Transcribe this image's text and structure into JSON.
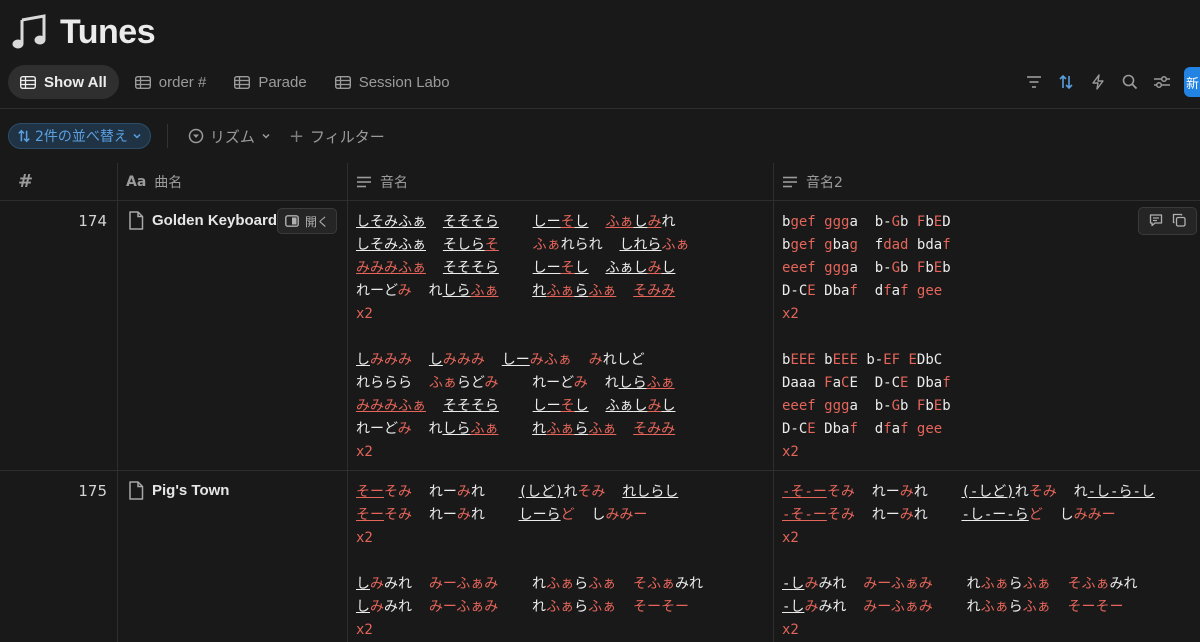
{
  "page": {
    "title": "Tunes",
    "icon": "music-notes-icon"
  },
  "views": [
    {
      "label": "Show All",
      "active": true
    },
    {
      "label": "order #",
      "active": false
    },
    {
      "label": "Parade",
      "active": false
    },
    {
      "label": "Session Labo",
      "active": false
    }
  ],
  "toolbar": {
    "new_label": "新"
  },
  "filters": {
    "sort_label": "2件の並べ替え",
    "rhythm_label": "リズム",
    "add_filter_label": "フィルター"
  },
  "columns": {
    "number": "#",
    "name": "曲名",
    "name_prefix": "Aa",
    "notes": "音名",
    "notes2": "音名2"
  },
  "accent_color": "#e5655a",
  "rows": [
    {
      "number": "174",
      "name": "Golden Keyboard",
      "open_label": "開く"
    },
    {
      "number": "175",
      "name": "Pig's Town"
    }
  ]
}
